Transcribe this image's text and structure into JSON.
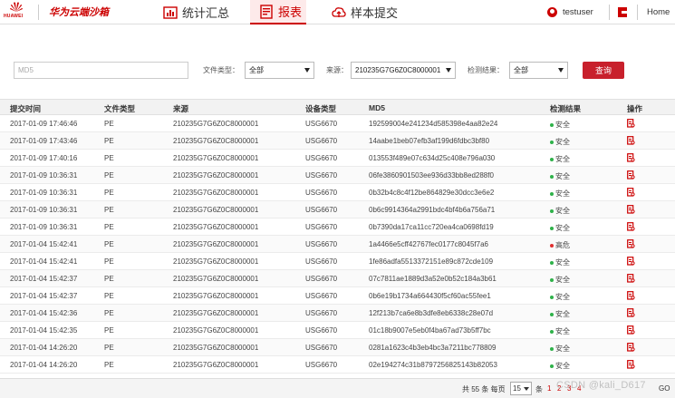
{
  "header": {
    "logo_text": "HUAWEI",
    "product_name": "华为云端沙箱",
    "tabs": [
      {
        "label": "统计汇总",
        "icon": "chart-icon",
        "active": false
      },
      {
        "label": "报表",
        "icon": "report-icon",
        "active": true
      },
      {
        "label": "样本提交",
        "icon": "upload-icon",
        "active": false
      }
    ],
    "username": "testuser",
    "home_label": "Home"
  },
  "filters": {
    "md5_placeholder": "MD5",
    "file_type_label": "文件类型：",
    "file_type_value": "全部",
    "source_label": "来源：",
    "source_value": "210235G7G6Z0C8000001",
    "result_label": "检测结果：",
    "result_value": "全部",
    "query_button": "查询"
  },
  "table": {
    "columns": [
      "提交时间",
      "文件类型",
      "来源",
      "设备类型",
      "MD5",
      "检测结果",
      "操作"
    ],
    "rows": [
      {
        "time": "2017-01-09 17:46:46",
        "type": "PE",
        "source": "210235G7G6Z0C8000001",
        "device": "USG6670",
        "md5": "192599004e241234d585398e4aa82e24",
        "result": "安全",
        "status": "safe"
      },
      {
        "time": "2017-01-09 17:43:46",
        "type": "PE",
        "source": "210235G7G6Z0C8000001",
        "device": "USG6670",
        "md5": "14aabe1beb07efb3af199d6fdbc3bf80",
        "result": "安全",
        "status": "safe"
      },
      {
        "time": "2017-01-09 17:40:16",
        "type": "PE",
        "source": "210235G7G6Z0C8000001",
        "device": "USG6670",
        "md5": "013553f489e07c634d25c408e796a030",
        "result": "安全",
        "status": "safe"
      },
      {
        "time": "2017-01-09 10:36:31",
        "type": "PE",
        "source": "210235G7G6Z0C8000001",
        "device": "USG6670",
        "md5": "06fe3860901503ee936d33bb8ed288f0",
        "result": "安全",
        "status": "safe"
      },
      {
        "time": "2017-01-09 10:36:31",
        "type": "PE",
        "source": "210235G7G6Z0C8000001",
        "device": "USG6670",
        "md5": "0b32b4c8c4f12be864829e30dcc3e6e2",
        "result": "安全",
        "status": "safe"
      },
      {
        "time": "2017-01-09 10:36:31",
        "type": "PE",
        "source": "210235G7G6Z0C8000001",
        "device": "USG6670",
        "md5": "0b6c9914364a2991bdc4bf4b6a756a71",
        "result": "安全",
        "status": "safe"
      },
      {
        "time": "2017-01-09 10:36:31",
        "type": "PE",
        "source": "210235G7G6Z0C8000001",
        "device": "USG6670",
        "md5": "0b7390da17ca11cc720ea4ca0698fd19",
        "result": "安全",
        "status": "safe"
      },
      {
        "time": "2017-01-04 15:42:41",
        "type": "PE",
        "source": "210235G7G6Z0C8000001",
        "device": "USG6670",
        "md5": "1a4466e5cff42767fec0177c8045f7a6",
        "result": "高危",
        "status": "danger"
      },
      {
        "time": "2017-01-04 15:42:41",
        "type": "PE",
        "source": "210235G7G6Z0C8000001",
        "device": "USG6670",
        "md5": "1fe86adfa5513372151e89c872cde109",
        "result": "安全",
        "status": "safe"
      },
      {
        "time": "2017-01-04 15:42:37",
        "type": "PE",
        "source": "210235G7G6Z0C8000001",
        "device": "USG6670",
        "md5": "07c7811ae1889d3a52e0b52c184a3b61",
        "result": "安全",
        "status": "safe"
      },
      {
        "time": "2017-01-04 15:42:37",
        "type": "PE",
        "source": "210235G7G6Z0C8000001",
        "device": "USG6670",
        "md5": "0b6e19b1734a664430f5cf60ac55fee1",
        "result": "安全",
        "status": "safe"
      },
      {
        "time": "2017-01-04 15:42:36",
        "type": "PE",
        "source": "210235G7G6Z0C8000001",
        "device": "USG6670",
        "md5": "12f213b7ca6e8b3dfe8eb6338c28e07d",
        "result": "安全",
        "status": "safe"
      },
      {
        "time": "2017-01-04 15:42:35",
        "type": "PE",
        "source": "210235G7G6Z0C8000001",
        "device": "USG6670",
        "md5": "01c18b9007e5eb0f4ba67ad73b5ff7bc",
        "result": "安全",
        "status": "safe"
      },
      {
        "time": "2017-01-04 14:26:20",
        "type": "PE",
        "source": "210235G7G6Z0C8000001",
        "device": "USG6670",
        "md5": "0281a1623c4b3eb4bc3a7211bc778809",
        "result": "安全",
        "status": "safe"
      },
      {
        "time": "2017-01-04 14:26:20",
        "type": "PE",
        "source": "210235G7G6Z0C8000001",
        "device": "USG6670",
        "md5": "02e194274c31b8797256825143b82053",
        "result": "安全",
        "status": "safe"
      }
    ]
  },
  "pagination": {
    "total_prefix": "共 55 条 每页",
    "per_page": "15",
    "per_page_suffix": "条",
    "pages": [
      "1",
      "2",
      "3",
      "4"
    ],
    "go_label": "GO"
  },
  "watermark": "CSDN @kali_D617",
  "colors": {
    "brand": "#c8202c",
    "safe": "#2fb24a",
    "danger": "#e03030"
  }
}
